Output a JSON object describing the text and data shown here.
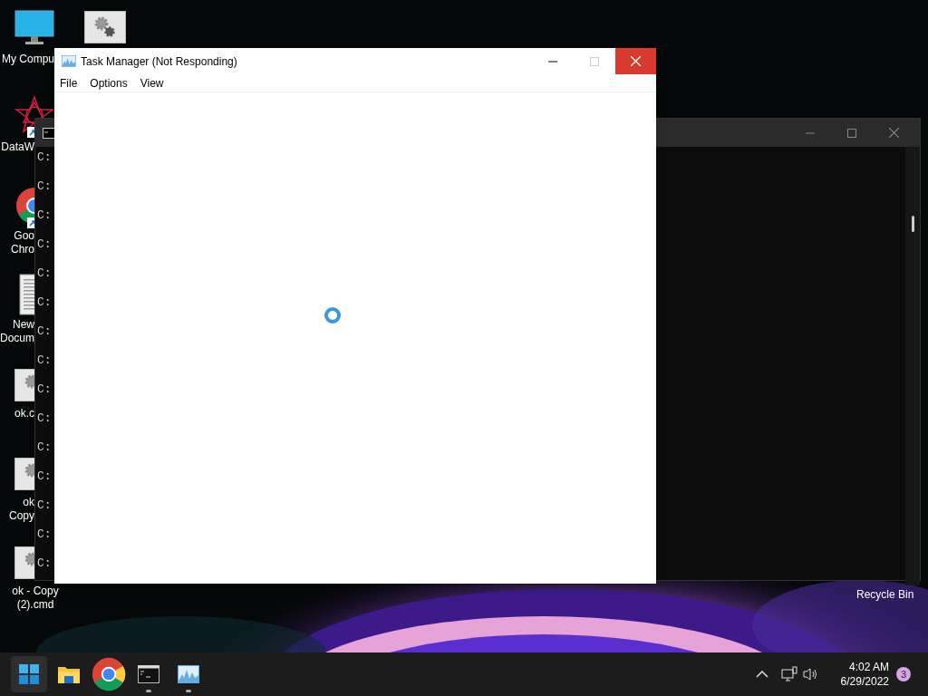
{
  "desktop_icons": [
    {
      "kind": "computer",
      "lines": [
        "My Compu"
      ],
      "shortcut": false
    },
    {
      "kind": "datawrapper",
      "lines": [
        "DataW"
      ],
      "shortcut": true
    },
    {
      "kind": "chrome",
      "lines": [
        "Goo",
        "Chro"
      ],
      "shortcut": true
    },
    {
      "kind": "document",
      "lines": [
        "New",
        "Docum"
      ],
      "shortcut": false
    },
    {
      "kind": "script",
      "lines": [
        "ok.c"
      ],
      "shortcut": false
    },
    {
      "kind": "script",
      "lines": [
        "ok",
        "Copy"
      ],
      "shortcut": false
    },
    {
      "kind": "script",
      "lines": [
        "ok - Copy",
        "(2).cmd"
      ],
      "shortcut": false
    }
  ],
  "top_icon": {
    "kind": "script"
  },
  "recycle_bin": {
    "label": "Recycle Bin"
  },
  "console_window": {
    "lines": [
      "C:",
      "C:",
      "C:",
      "C:",
      "C:",
      "C:",
      "C:",
      "C:",
      "C:",
      "C:",
      "C:",
      "C:",
      "C:",
      "C:",
      "C:"
    ]
  },
  "task_manager": {
    "title": "Task Manager (Not Responding)",
    "maximize_disabled": true,
    "menu": [
      "File",
      "Options",
      "View"
    ],
    "loading": true
  },
  "taskbar": {
    "apps": [
      {
        "kind": "start",
        "selected": true,
        "running": false
      },
      {
        "kind": "explorer",
        "selected": false,
        "running": false
      },
      {
        "kind": "chrome",
        "selected": false,
        "running": false
      },
      {
        "kind": "terminal",
        "selected": false,
        "running": true
      },
      {
        "kind": "taskmanager",
        "selected": false,
        "running": true
      }
    ],
    "time": "4:02 AM",
    "date": "6/29/2022",
    "notification_count": "3"
  }
}
